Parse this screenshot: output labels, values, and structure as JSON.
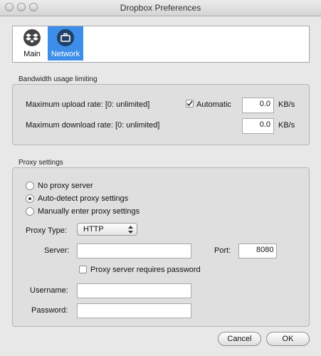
{
  "window": {
    "title": "Dropbox Preferences"
  },
  "toolbar": {
    "items": [
      {
        "label": "Main",
        "icon": "dropbox-icon",
        "selected": false
      },
      {
        "label": "Network",
        "icon": "briefcase-icon",
        "selected": true
      }
    ]
  },
  "bandwidth": {
    "group_label": "Bandwidth usage limiting",
    "upload_label": "Maximum upload rate: [0: unlimited]",
    "automatic_label": "Automatic",
    "automatic_checked": true,
    "upload_value": "0.0",
    "upload_unit": "KB/s",
    "download_label": "Maximum download rate: [0: unlimited]",
    "download_value": "0.0",
    "download_unit": "KB/s"
  },
  "proxy": {
    "group_label": "Proxy settings",
    "options": [
      "No proxy server",
      "Auto-detect proxy settings",
      "Manually enter proxy settings"
    ],
    "selected_option": "Auto-detect proxy settings",
    "type_label": "Proxy Type:",
    "type_value": "HTTP",
    "server_label": "Server:",
    "server_value": "",
    "port_label": "Port:",
    "port_value": "8080",
    "requires_password_label": "Proxy server requires password",
    "requires_password_checked": false,
    "username_label": "Username:",
    "username_value": "",
    "password_label": "Password:",
    "password_value": ""
  },
  "buttons": {
    "cancel": "Cancel",
    "ok": "OK"
  }
}
